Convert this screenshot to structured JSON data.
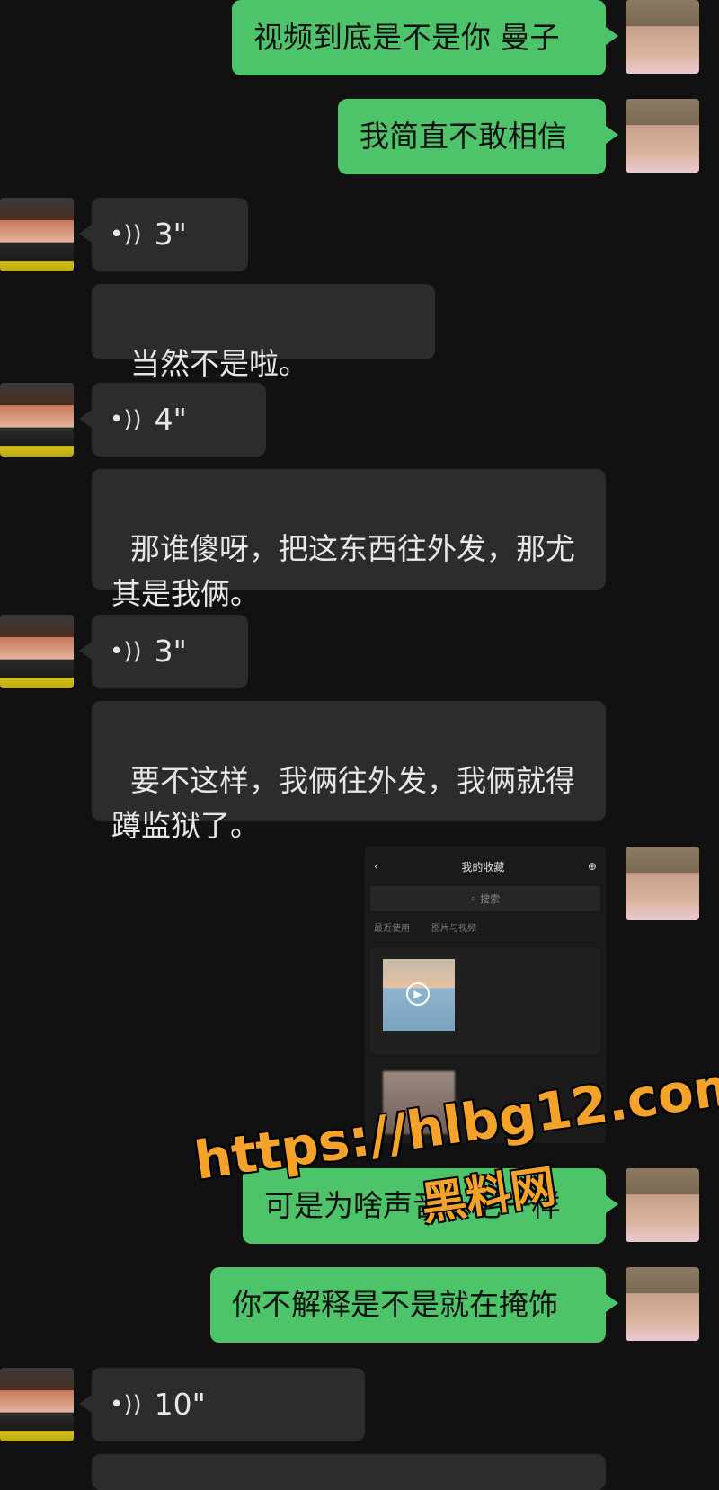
{
  "messages": {
    "m1": "视频到底是不是你 曼子",
    "m2": "我简直不敢相信",
    "v1": "3\"",
    "m3": "当然不是啦。",
    "v2": "4\"",
    "m4": "那谁傻呀，把这东西往外发，那尤\n其是我俩。",
    "v3": "3\"",
    "m5": "要不这样，我俩往外发，我俩就得\n蹲监狱了。",
    "m6": "可是为啥声音一毛一样",
    "m7": "你不解释是不是就在掩饰",
    "v4": "10\""
  },
  "screenshot": {
    "title": "我的收藏",
    "search": "搜索",
    "tab1": "最近使用",
    "tab2": "图片与视频"
  },
  "watermark": {
    "url": "https://hlbg12.com",
    "site": "黑料网"
  }
}
